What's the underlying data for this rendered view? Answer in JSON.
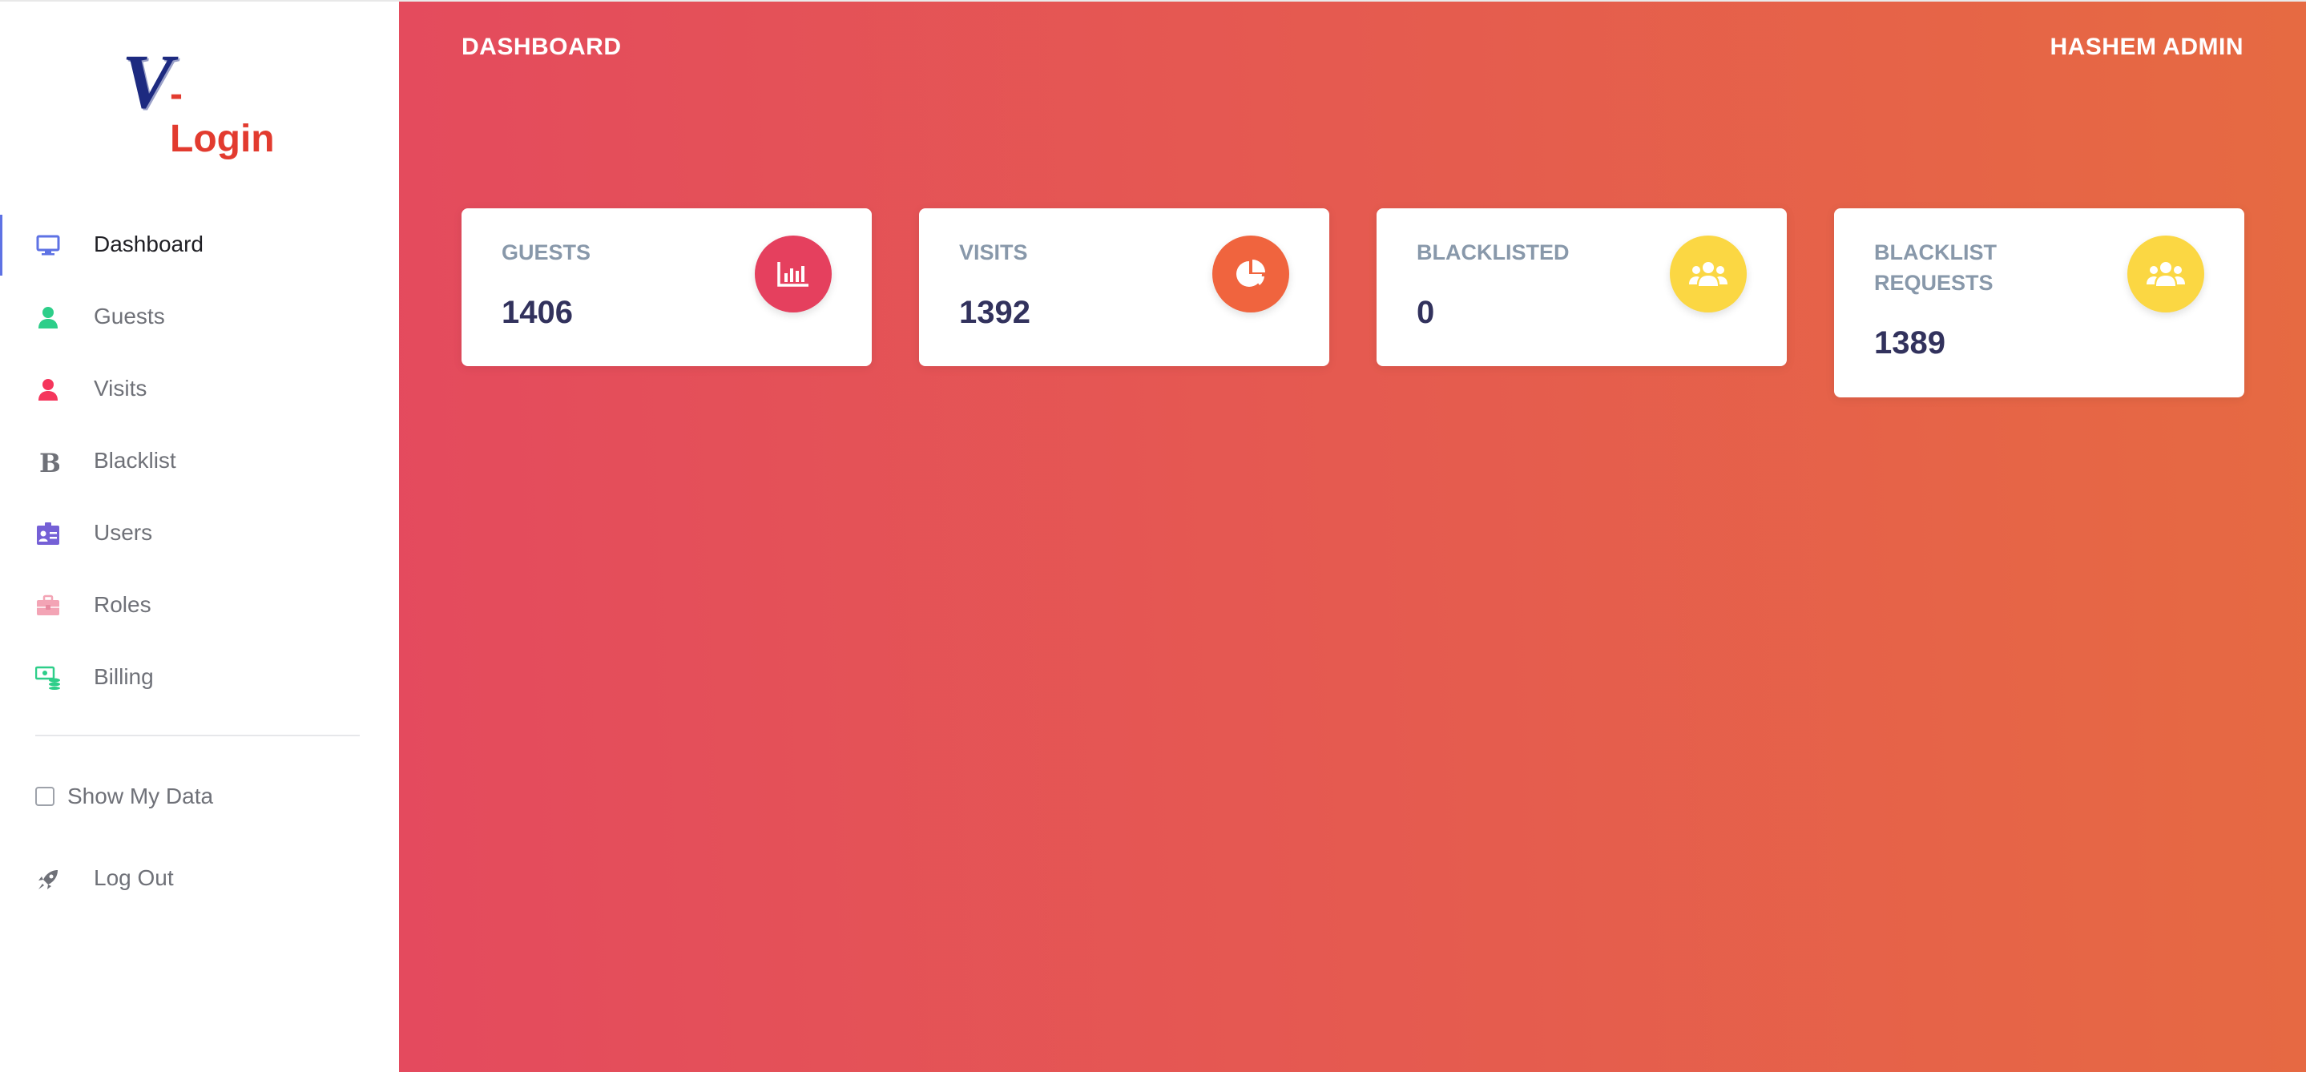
{
  "brand": {
    "logo_v": "V",
    "logo_rest": "-Login"
  },
  "sidebar": {
    "items": [
      {
        "label": "Dashboard",
        "icon": "monitor-icon",
        "color": "#5e72e4",
        "active": true
      },
      {
        "label": "Guests",
        "icon": "person-icon",
        "color": "#2dce89"
      },
      {
        "label": "Visits",
        "icon": "person-icon",
        "color": "#f5365c"
      },
      {
        "label": "Blacklist",
        "icon": "letter-b-icon",
        "color": "#6f7178"
      },
      {
        "label": "Users",
        "icon": "id-card-icon",
        "color": "#7560d6"
      },
      {
        "label": "Roles",
        "icon": "briefcase-icon",
        "color": "#f3a4b5"
      },
      {
        "label": "Billing",
        "icon": "money-icon",
        "color": "#2dce89"
      }
    ],
    "show_my_data": {
      "label": "Show My Data",
      "checked": false
    },
    "logout": {
      "label": "Log Out",
      "icon": "rocket-icon"
    }
  },
  "header": {
    "title": "DASHBOARD",
    "user": "HASHEM ADMIN"
  },
  "cards": [
    {
      "label": "GUESTS",
      "value": "1406",
      "icon": "bar-chart-icon",
      "color": "#e5405e"
    },
    {
      "label": "VISITS",
      "value": "1392",
      "icon": "pie-chart-icon",
      "color": "#f0643e"
    },
    {
      "label": "BLACKLISTED",
      "value": "0",
      "icon": "users-icon",
      "color": "#fbd743"
    },
    {
      "label": "BLACKLIST REQUESTS",
      "value": "1389",
      "icon": "users-icon",
      "color": "#fbd743"
    }
  ],
  "colors": {
    "gradient_start": "#e44a5e",
    "gradient_end": "#e66a42",
    "card_label": "#8898aa",
    "card_value": "#32325d"
  }
}
